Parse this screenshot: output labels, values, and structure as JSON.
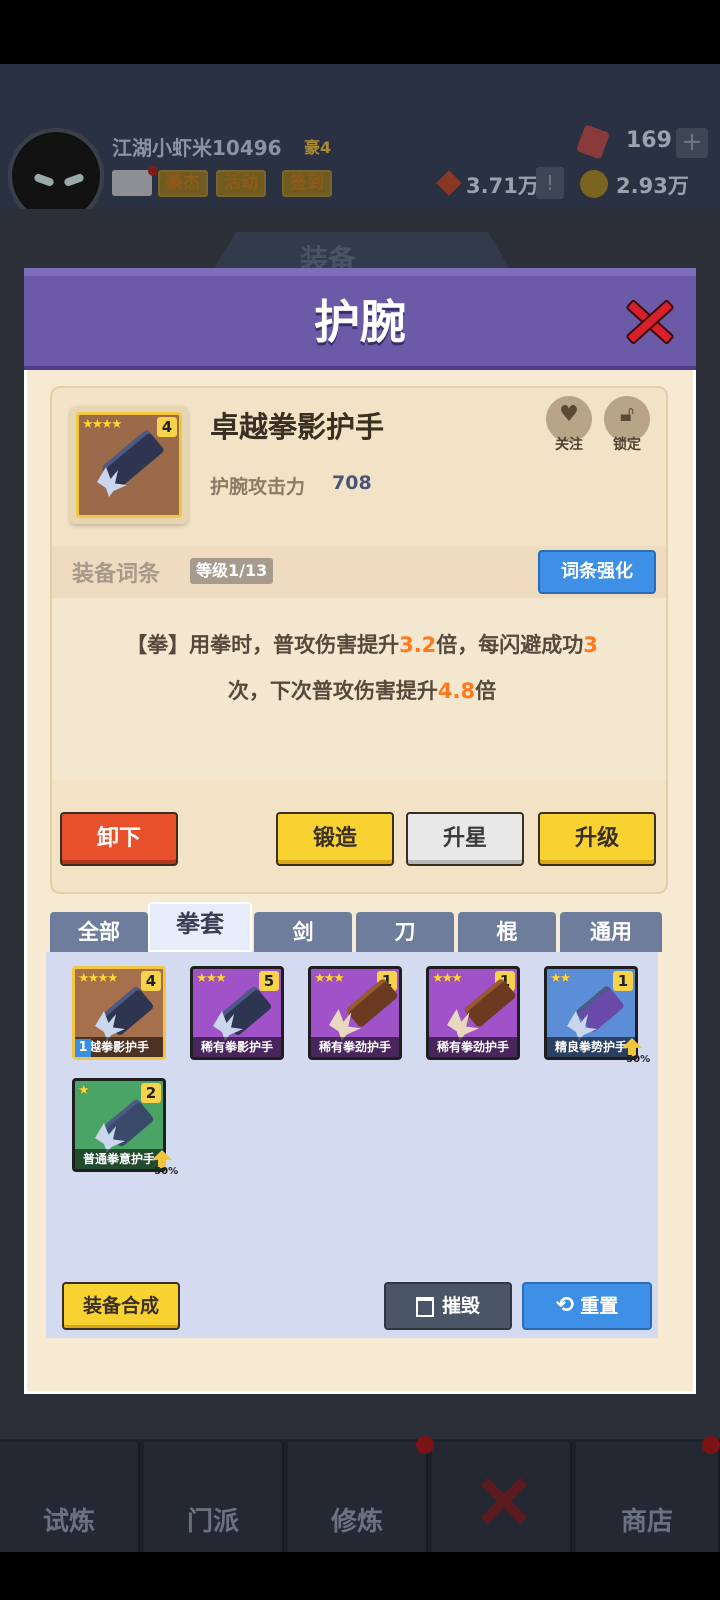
{
  "header": {
    "player_name": "江湖小虾米10496",
    "rank": "豪4",
    "buttons": [
      "豪杰",
      "活动",
      "签到"
    ],
    "gems": "169",
    "power": "3.71万",
    "coins": "2.93万",
    "plus": "+",
    "info": "!"
  },
  "background": {
    "screen_title": "装备"
  },
  "dialog": {
    "title": "护腕",
    "item": {
      "name": "卓越拳影护手",
      "stars": "★★★★",
      "level": "4",
      "attack_label": "护腕攻击力",
      "attack_value": "708",
      "follow_label": "关注",
      "lock_label": "锁定"
    },
    "affix": {
      "title": "装备词条",
      "level": "等级1/13",
      "enhance_button": "词条强化",
      "desc_parts": [
        "【拳】用拳时，普攻伤害提升",
        "3.2",
        "倍，每闪避成功",
        "3",
        "次，下次普攻伤害提升",
        "4.8",
        "倍"
      ]
    },
    "actions": {
      "unequip": "卸下",
      "forge": "锻造",
      "star_up": "升星",
      "upgrade": "升级"
    },
    "tabs": [
      "全部",
      "拳套",
      "剑",
      "刀",
      "棍",
      "通用"
    ],
    "active_tab": "拳套",
    "inventory": [
      {
        "name": "越拳影护手",
        "stars": "★★★★",
        "count": "4",
        "equipped_mark": "1",
        "rarity": "orange"
      },
      {
        "name": "稀有拳影护手",
        "stars": "★★★",
        "count": "5",
        "rarity": "purple"
      },
      {
        "name": "稀有拳劲护手",
        "stars": "★★★",
        "count": "1",
        "rarity": "purple"
      },
      {
        "name": "稀有拳劲护手",
        "stars": "★★★",
        "count": "1",
        "rarity": "purple"
      },
      {
        "name": "精良拳势护手",
        "stars": "★★",
        "count": "1",
        "rarity": "blue",
        "discount": "-50%"
      },
      {
        "name": "普通拳意护手",
        "stars": "★",
        "count": "2",
        "rarity": "green",
        "discount": "-50%"
      }
    ],
    "footer": {
      "compose": "装备合成",
      "destroy": "摧毁",
      "reset": "重置"
    }
  },
  "bottom_nav": [
    "试炼",
    "门派",
    "修炼",
    "",
    "商店"
  ],
  "colors": {
    "dialog_header": "#6a5aa8",
    "highlight": "#ff7a1a",
    "primary_blue": "#3e8fe6",
    "button_yellow": "#f7d230",
    "button_red": "#e8502c"
  }
}
